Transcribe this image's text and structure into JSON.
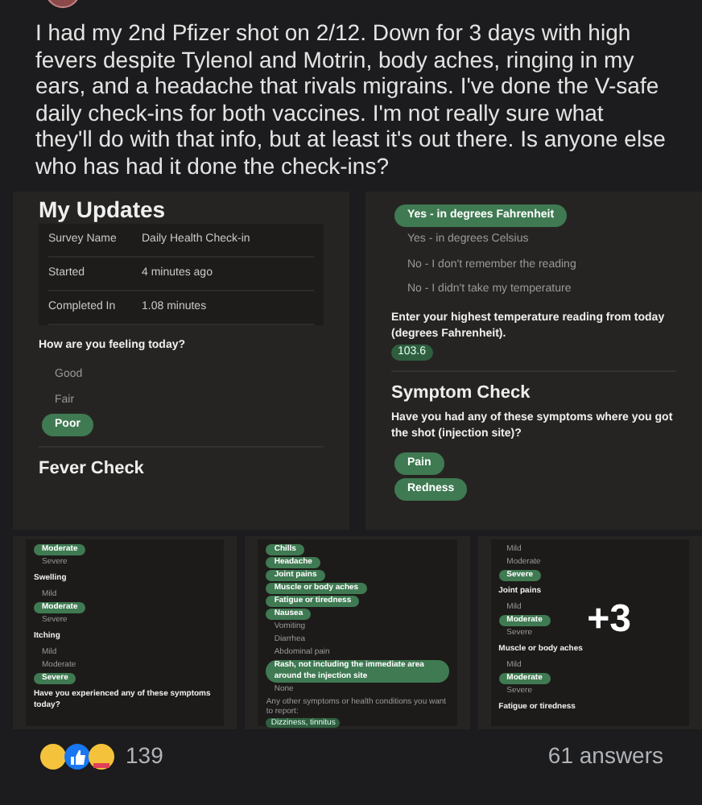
{
  "post": {
    "text": "I had my 2nd Pfizer shot on 2/12. Down for 3 days with high fevers despite Tylenol and Motrin, body aches, ringing in my ears, and a headache that rivals migrains. I've done the V-safe daily check-ins for both vaccines. I'm not really sure what they'll do with that info, but at least it's out there. Is anyone else who has had it  done the check-ins?"
  },
  "large_images": [
    {
      "blocks": [
        {
          "kind": "heading",
          "text": "My Updates"
        },
        {
          "kind": "info_table",
          "rows": [
            {
              "label": "Survey Name",
              "value": "Daily Health Check-in"
            },
            {
              "label": "Started",
              "value": "4 minutes ago"
            },
            {
              "label": "Completed In",
              "value": "1.08 minutes"
            }
          ]
        },
        {
          "kind": "question",
          "text": "How are you feeling today?"
        },
        {
          "kind": "option",
          "text": "Good",
          "selected": false
        },
        {
          "kind": "option",
          "text": "Fair",
          "selected": false
        },
        {
          "kind": "option",
          "text": "Poor",
          "selected": true
        },
        {
          "kind": "section",
          "text": "Fever Check"
        }
      ]
    },
    {
      "blocks": [
        {
          "kind": "option",
          "text": "Yes - in degrees Fahrenheit",
          "selected": true
        },
        {
          "kind": "option",
          "text": "Yes - in degrees Celsius",
          "selected": false
        },
        {
          "kind": "option",
          "text": "No - I don't remember the reading",
          "selected": false
        },
        {
          "kind": "option",
          "text": "No - I didn't take my temperature",
          "selected": false
        },
        {
          "kind": "prompt_value",
          "text": "Enter your highest temperature reading from today (degrees Fahrenheit).",
          "value": "103.6"
        },
        {
          "kind": "section",
          "text": "Symptom Check"
        },
        {
          "kind": "question",
          "text": "Have you had any of these symptoms where you got the shot (injection site)?"
        },
        {
          "kind": "option",
          "text": "Pain",
          "selected": true
        },
        {
          "kind": "option",
          "text": "Redness",
          "selected": true
        }
      ]
    }
  ],
  "small_images": [
    {
      "blocks": [
        {
          "kind": "option",
          "text": "Moderate",
          "selected": true
        },
        {
          "kind": "option",
          "text": "Severe",
          "selected": false
        },
        {
          "kind": "question",
          "text": "Swelling"
        },
        {
          "kind": "option",
          "text": "Mild",
          "selected": false
        },
        {
          "kind": "option",
          "text": "Moderate",
          "selected": true
        },
        {
          "kind": "option",
          "text": "Severe",
          "selected": false
        },
        {
          "kind": "question",
          "text": "Itching"
        },
        {
          "kind": "option",
          "text": "Mild",
          "selected": false
        },
        {
          "kind": "option",
          "text": "Moderate",
          "selected": false
        },
        {
          "kind": "option",
          "text": "Severe",
          "selected": true
        },
        {
          "kind": "question",
          "text": "Have you experienced any of these symptoms today?"
        }
      ]
    },
    {
      "blocks": [
        {
          "kind": "option",
          "text": "Chills",
          "selected": true
        },
        {
          "kind": "option",
          "text": "Headache",
          "selected": true
        },
        {
          "kind": "option",
          "text": "Joint pains",
          "selected": true
        },
        {
          "kind": "option",
          "text": "Muscle or body aches",
          "selected": true
        },
        {
          "kind": "option",
          "text": "Fatigue or tiredness",
          "selected": true
        },
        {
          "kind": "option",
          "text": "Nausea",
          "selected": true
        },
        {
          "kind": "option",
          "text": "Vomiting",
          "selected": false
        },
        {
          "kind": "option",
          "text": "Diarrhea",
          "selected": false
        },
        {
          "kind": "option",
          "text": "Abdominal pain",
          "selected": false
        },
        {
          "kind": "option",
          "text": "Rash, not including the immediate area around the injection site",
          "selected": true
        },
        {
          "kind": "option",
          "text": "None",
          "selected": false
        },
        {
          "kind": "prompt_value",
          "text": "Any other symptoms or health conditions you want to report:",
          "value": "Dizziness, tinnitus"
        }
      ]
    },
    {
      "overlay": "+3",
      "blocks": [
        {
          "kind": "option",
          "text": "Mild",
          "selected": false
        },
        {
          "kind": "option",
          "text": "Moderate",
          "selected": false
        },
        {
          "kind": "option",
          "text": "Severe",
          "selected": true
        },
        {
          "kind": "question",
          "text": "Joint pains"
        },
        {
          "kind": "option",
          "text": "Mild",
          "selected": false
        },
        {
          "kind": "option",
          "text": "Moderate",
          "selected": true
        },
        {
          "kind": "option",
          "text": "Severe",
          "selected": false
        },
        {
          "kind": "question",
          "text": "Muscle or body aches"
        },
        {
          "kind": "option",
          "text": "Mild",
          "selected": false
        },
        {
          "kind": "option",
          "text": "Moderate",
          "selected": true
        },
        {
          "kind": "option",
          "text": "Severe",
          "selected": false
        },
        {
          "kind": "question",
          "text": "Fatigue or tiredness"
        }
      ]
    }
  ],
  "footer": {
    "reaction_count": "139",
    "answers": "61 answers"
  }
}
